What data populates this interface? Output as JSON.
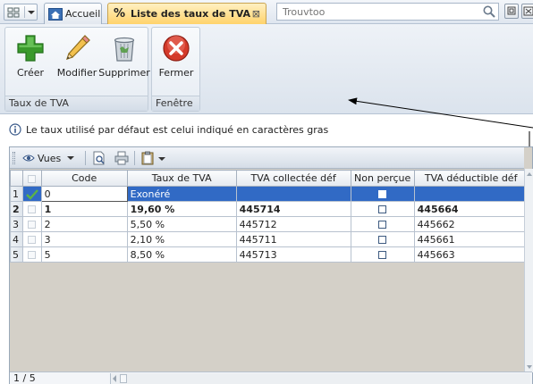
{
  "tabbar": {
    "home_label": "Accueil",
    "active_tab_symbol": "%",
    "active_tab_label": "Liste des taux de TVA",
    "active_tab_close": "⊠",
    "search_placeholder": "Trouvtoo"
  },
  "ribbon": {
    "groups": [
      {
        "title": "Taux de TVA",
        "buttons": [
          "Créer",
          "Modifier",
          "Supprimer"
        ]
      },
      {
        "title": "Fenêtre",
        "buttons": [
          "Fermer"
        ]
      }
    ]
  },
  "info": {
    "text": "Le taux utilisé par défaut est celui indiqué en caractères gras"
  },
  "grid_toolbar": {
    "views_label": "Vues"
  },
  "table": {
    "columns": [
      "",
      "",
      "Code",
      "Taux de TVA",
      "TVA collectée déf",
      "Non perçue",
      "TVA déductible déf"
    ],
    "rows": [
      {
        "num": "1",
        "code": "0",
        "rate": "Exonéré",
        "collected": "",
        "non_percue": false,
        "deductible": "",
        "selected": true,
        "bold": false,
        "checked": true
      },
      {
        "num": "2",
        "code": "1",
        "rate": "19,60 %",
        "collected": "445714",
        "non_percue": false,
        "deductible": "445664",
        "selected": false,
        "bold": true,
        "checked": false
      },
      {
        "num": "3",
        "code": "2",
        "rate": "5,50 %",
        "collected": "445712",
        "non_percue": false,
        "deductible": "445662",
        "selected": false,
        "bold": false,
        "checked": false
      },
      {
        "num": "4",
        "code": "3",
        "rate": "2,10 %",
        "collected": "445711",
        "non_percue": false,
        "deductible": "445661",
        "selected": false,
        "bold": false,
        "checked": false
      },
      {
        "num": "5",
        "code": "5",
        "rate": "8,50 %",
        "collected": "445713",
        "non_percue": false,
        "deductible": "445663",
        "selected": false,
        "bold": false,
        "checked": false
      }
    ]
  },
  "status": {
    "record_count": "1 / 5"
  },
  "colors": {
    "selection": "#316ac5",
    "active_tab": "#ffd36b",
    "create_icon": "#3a9a2c",
    "close_icon": "#d43a2a"
  },
  "icons": [
    "grid-icon",
    "home-icon",
    "search-icon",
    "create-plus-icon",
    "pencil-icon",
    "trash-icon",
    "close-circle-icon",
    "info-icon",
    "eye-icon",
    "print-preview-icon",
    "print-icon",
    "clipboard-icon",
    "checkmark-icon"
  ]
}
